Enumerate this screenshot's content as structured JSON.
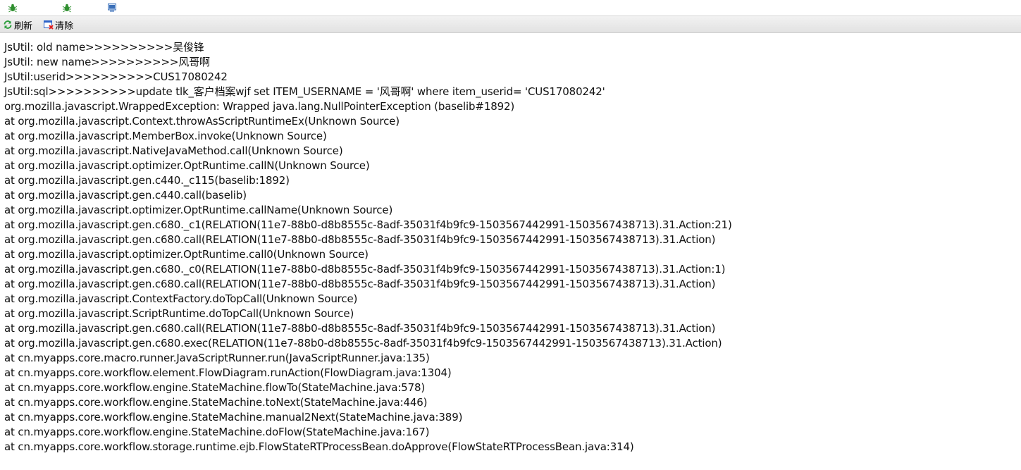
{
  "tabs": [
    {
      "icon": "bug-icon"
    },
    {
      "icon": "bug-icon"
    },
    {
      "icon": "monitor-icon"
    }
  ],
  "toolbar": {
    "refresh_label": "刷新",
    "clear_label": "清除"
  },
  "colors": {
    "refresh_icon": "#2e9e3e",
    "clear_icon_frame": "#2d62c8",
    "clear_icon_x": "#e02020",
    "bug_icon": "#2f8f2f",
    "monitor_icon": "#3a6fb8"
  },
  "log_lines": [
    "JsUtil: old name>>>>>>>>>>吴俊锋",
    "JsUtil: new name>>>>>>>>>>风哥啊",
    "JsUtil:userid>>>>>>>>>>CUS17080242",
    "JsUtil:sql>>>>>>>>>>update tlk_客户档案wjf set ITEM_USERNAME = '风哥啊' where item_userid= 'CUS17080242'",
    "org.mozilla.javascript.WrappedException: Wrapped java.lang.NullPointerException (baselib#1892)",
    "at org.mozilla.javascript.Context.throwAsScriptRuntimeEx(Unknown Source)",
    "at org.mozilla.javascript.MemberBox.invoke(Unknown Source)",
    "at org.mozilla.javascript.NativeJavaMethod.call(Unknown Source)",
    "at org.mozilla.javascript.optimizer.OptRuntime.callN(Unknown Source)",
    "at org.mozilla.javascript.gen.c440._c115(baselib:1892)",
    "at org.mozilla.javascript.gen.c440.call(baselib)",
    "at org.mozilla.javascript.optimizer.OptRuntime.callName(Unknown Source)",
    "at org.mozilla.javascript.gen.c680._c1(RELATION(11e7-88b0-d8b8555c-8adf-35031f4b9fc9-1503567442991-1503567438713).31.Action:21)",
    "at org.mozilla.javascript.gen.c680.call(RELATION(11e7-88b0-d8b8555c-8adf-35031f4b9fc9-1503567442991-1503567438713).31.Action)",
    "at org.mozilla.javascript.optimizer.OptRuntime.call0(Unknown Source)",
    "at org.mozilla.javascript.gen.c680._c0(RELATION(11e7-88b0-d8b8555c-8adf-35031f4b9fc9-1503567442991-1503567438713).31.Action:1)",
    "at org.mozilla.javascript.gen.c680.call(RELATION(11e7-88b0-d8b8555c-8adf-35031f4b9fc9-1503567442991-1503567438713).31.Action)",
    "at org.mozilla.javascript.ContextFactory.doTopCall(Unknown Source)",
    "at org.mozilla.javascript.ScriptRuntime.doTopCall(Unknown Source)",
    "at org.mozilla.javascript.gen.c680.call(RELATION(11e7-88b0-d8b8555c-8adf-35031f4b9fc9-1503567442991-1503567438713).31.Action)",
    "at org.mozilla.javascript.gen.c680.exec(RELATION(11e7-88b0-d8b8555c-8adf-35031f4b9fc9-1503567442991-1503567438713).31.Action)",
    "at cn.myapps.core.macro.runner.JavaScriptRunner.run(JavaScriptRunner.java:135)",
    "at cn.myapps.core.workflow.element.FlowDiagram.runAction(FlowDiagram.java:1304)",
    "at cn.myapps.core.workflow.engine.StateMachine.flowTo(StateMachine.java:578)",
    "at cn.myapps.core.workflow.engine.StateMachine.toNext(StateMachine.java:446)",
    "at cn.myapps.core.workflow.engine.StateMachine.manual2Next(StateMachine.java:389)",
    "at cn.myapps.core.workflow.engine.StateMachine.doFlow(StateMachine.java:167)",
    "at cn.myapps.core.workflow.storage.runtime.ejb.FlowStateRTProcessBean.doApprove(FlowStateRTProcessBean.java:314)"
  ]
}
